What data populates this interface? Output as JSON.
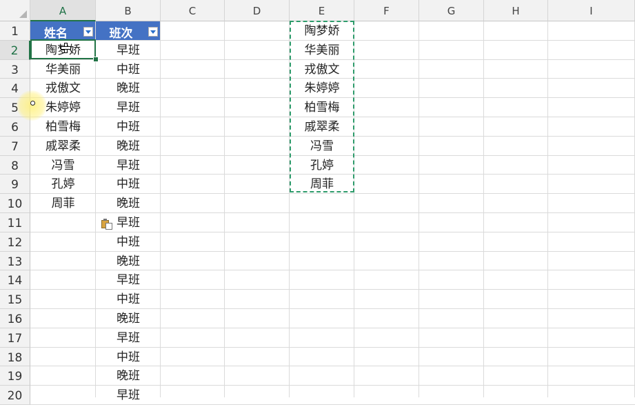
{
  "columns": [
    "A",
    "B",
    "C",
    "D",
    "E",
    "F",
    "G",
    "H",
    "I"
  ],
  "selected_column": "A",
  "rows": [
    "1",
    "2",
    "3",
    "4",
    "5",
    "6",
    "7",
    "8",
    "9",
    "10",
    "11",
    "12",
    "13",
    "14",
    "15",
    "16",
    "17",
    "18",
    "19",
    "20"
  ],
  "selected_row": "2",
  "table_headers": {
    "name": "姓名",
    "shift": "班次"
  },
  "names": [
    "陶梦娇",
    "华美丽",
    "戎傲文",
    "朱婷婷",
    "柏雪梅",
    "戚翠柔",
    "冯雪",
    "孔婷",
    "周菲"
  ],
  "shifts": [
    "早班",
    "中班",
    "晚班",
    "早班",
    "中班",
    "晚班",
    "早班",
    "中班",
    "晚班",
    "早班",
    "中班",
    "晚班",
    "早班",
    "中班",
    "晚班",
    "早班",
    "中班",
    "晚班",
    "早班"
  ],
  "copied_names": [
    "陶梦娇",
    "华美丽",
    "戎傲文",
    "朱婷婷",
    "柏雪梅",
    "戚翠柔",
    "冯雪",
    "孔婷",
    "周菲"
  ],
  "active_cell": "A2",
  "colors": {
    "header_fill": "#4472c4",
    "selection": "#217346",
    "marquee": "#2e9b6b"
  }
}
